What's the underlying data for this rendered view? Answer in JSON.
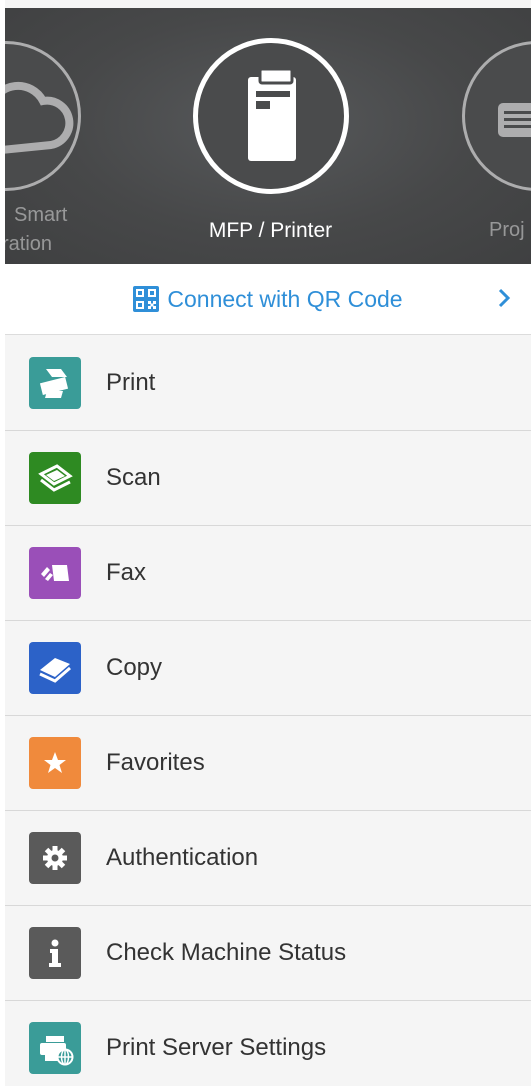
{
  "carousel": {
    "left_label_line1": "Smart",
    "left_label_line2": "ration",
    "center_label": "MFP / Printer",
    "right_label": "Proj",
    "left_icon": "cloud-icon",
    "center_icon": "mfp-printer-icon",
    "right_icon": "projector-icon"
  },
  "qr": {
    "label": "Connect with QR Code",
    "icon": "qr-code-icon",
    "color": "#2f8fd8"
  },
  "menu": {
    "items": [
      {
        "label": "Print",
        "icon": "print-icon",
        "color": "#3a9c98"
      },
      {
        "label": "Scan",
        "icon": "scan-icon",
        "color": "#2e8a22"
      },
      {
        "label": "Fax",
        "icon": "fax-icon",
        "color": "#9a4fb8"
      },
      {
        "label": "Copy",
        "icon": "copy-icon",
        "color": "#2c62c8"
      },
      {
        "label": "Favorites",
        "icon": "star-icon",
        "color": "#f08a3c"
      },
      {
        "label": "Authentication",
        "icon": "gear-icon",
        "color": "#5a5a5a"
      },
      {
        "label": "Check Machine Status",
        "icon": "info-icon",
        "color": "#5a5a5a"
      },
      {
        "label": "Print Server Settings",
        "icon": "print-server-icon",
        "color": "#3a9c98"
      }
    ]
  }
}
